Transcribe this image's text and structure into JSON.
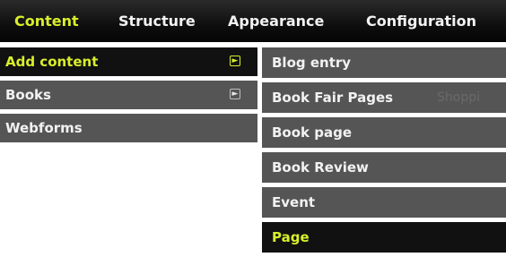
{
  "topbar": {
    "tabs": [
      {
        "label": "Content"
      },
      {
        "label": "Structure"
      },
      {
        "label": "Appearance"
      },
      {
        "label": "Configuration"
      }
    ]
  },
  "content_menu": {
    "items": [
      {
        "label": "Add content",
        "submenu_icon": "submenu-arrow-icon"
      },
      {
        "label": "Books",
        "submenu_icon": "submenu-arrow-icon"
      },
      {
        "label": "Webforms"
      }
    ]
  },
  "add_content_submenu": {
    "items": [
      {
        "label": "Blog entry"
      },
      {
        "label": "Book Fair Pages"
      },
      {
        "label": "Book page"
      },
      {
        "label": "Book Review"
      },
      {
        "label": "Event"
      },
      {
        "label": "Page"
      }
    ],
    "background_partial_text": "Shoppi"
  },
  "colors": {
    "accent": "#d9ef2a",
    "bar": "#0e0e0e",
    "item": "#555555",
    "item_active": "#111111"
  }
}
